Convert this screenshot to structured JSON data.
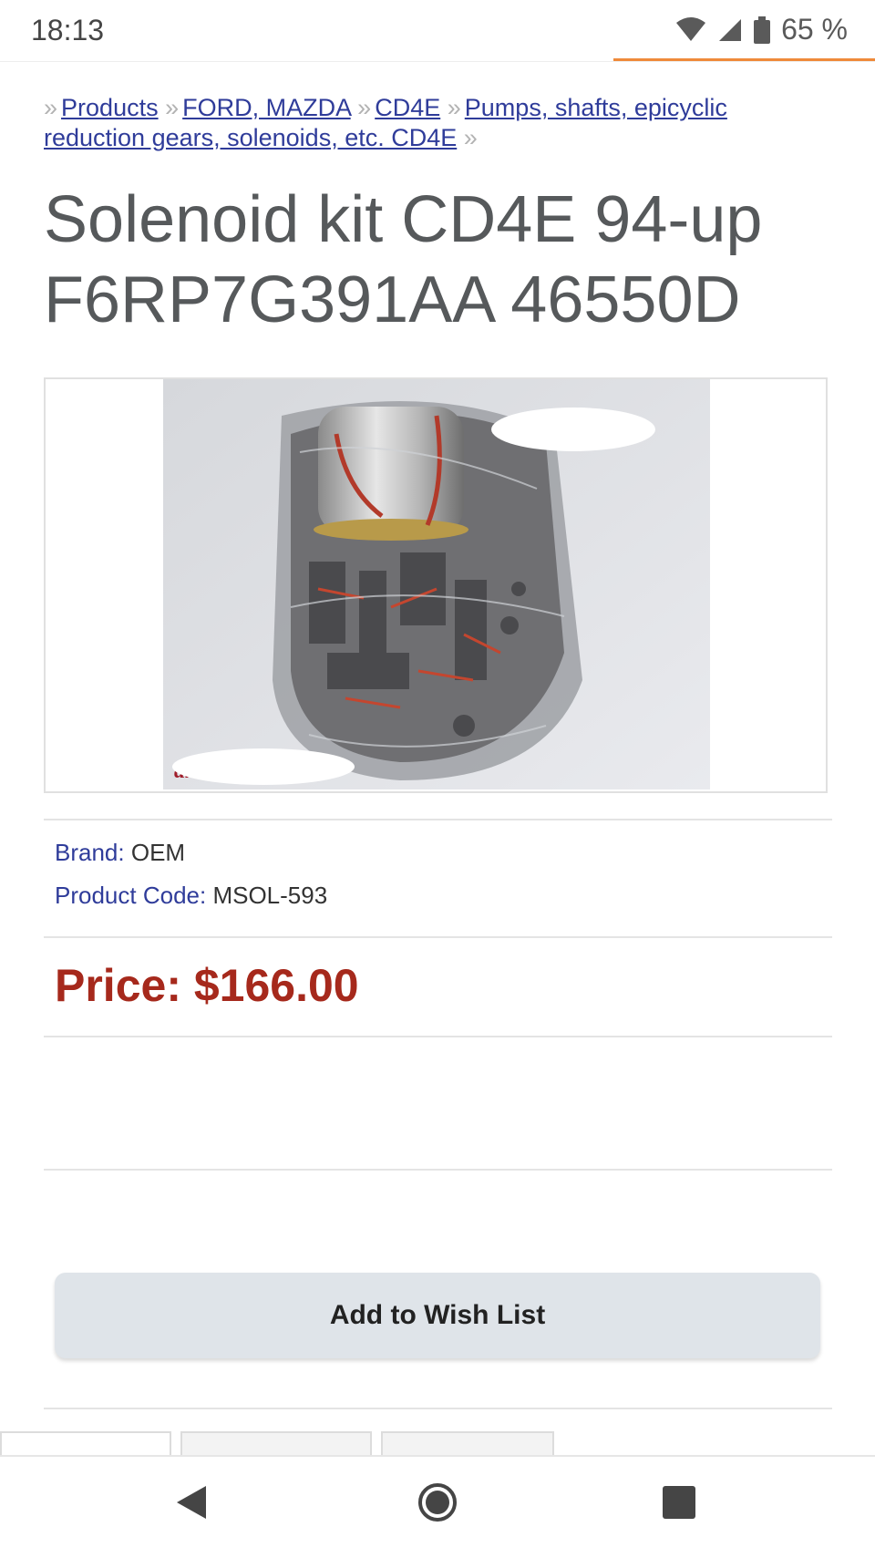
{
  "status_bar": {
    "time": "18:13",
    "battery_text": "65 %",
    "icons": [
      "wifi-icon",
      "cell-signal-icon",
      "battery-icon"
    ]
  },
  "breadcrumb": {
    "items": [
      {
        "label": "Products"
      },
      {
        "label": "FORD, MAZDA"
      },
      {
        "label": "CD4E"
      },
      {
        "label": "Pumps, shafts, epicyclic reduction gears, solenoids, etc. CD4E"
      }
    ],
    "separator": "»"
  },
  "product": {
    "title": "Solenoid kit CD4E 94-up F6RP7G391AA 46550D",
    "brand_label": "Brand:",
    "brand_value": "OEM",
    "code_label": "Product Code:",
    "code_value": "MSOL-593",
    "price": "Price: $166.00"
  },
  "actions": {
    "wish_list": "Add to Wish List"
  },
  "colors": {
    "link": "#2f3c9a",
    "price": "#a6291c",
    "accent_progress": "#ef8a3a",
    "title": "#56595b"
  },
  "nav": {
    "icons": [
      "back-icon",
      "home-icon",
      "recents-icon"
    ]
  }
}
